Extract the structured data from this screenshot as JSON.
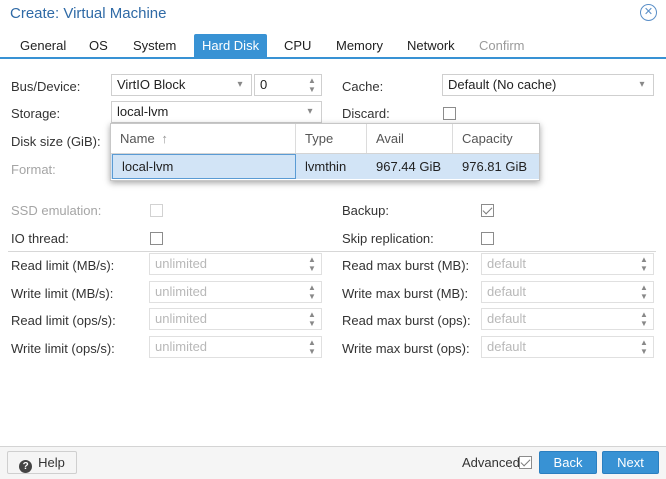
{
  "window": {
    "title": "Create: Virtual Machine"
  },
  "tabs": [
    {
      "label": "General"
    },
    {
      "label": "OS"
    },
    {
      "label": "System"
    },
    {
      "label": "Hard Disk"
    },
    {
      "label": "CPU"
    },
    {
      "label": "Memory"
    },
    {
      "label": "Network"
    },
    {
      "label": "Confirm"
    }
  ],
  "disk": {
    "bus_label": "Bus/Device:",
    "bus_value": "VirtIO Block",
    "device_value": "0",
    "storage_label": "Storage:",
    "storage_value": "local-lvm",
    "size_label": "Disk size (GiB):",
    "format_label": "Format:",
    "cache_label": "Cache:",
    "cache_value": "Default (No cache)",
    "discard_label": "Discard:"
  },
  "storage_picker": {
    "columns": [
      "Name",
      "Type",
      "Avail",
      "Capacity"
    ],
    "sort_arrow": "↑",
    "rows": [
      {
        "name": "local-lvm",
        "type": "lvmthin",
        "avail": "967.44 GiB",
        "capacity": "976.81 GiB"
      }
    ]
  },
  "advanced": {
    "ssd_label": "SSD emulation:",
    "iothread_label": "IO thread:",
    "backup_label": "Backup:",
    "skip_replication_label": "Skip replication:",
    "limits_left": [
      {
        "label": "Read limit (MB/s):",
        "placeholder": "unlimited"
      },
      {
        "label": "Write limit (MB/s):",
        "placeholder": "unlimited"
      },
      {
        "label": "Read limit (ops/s):",
        "placeholder": "unlimited"
      },
      {
        "label": "Write limit (ops/s):",
        "placeholder": "unlimited"
      }
    ],
    "limits_right": [
      {
        "label": "Read max burst (MB):",
        "placeholder": "default"
      },
      {
        "label": "Write max burst (MB):",
        "placeholder": "default"
      },
      {
        "label": "Read max burst (ops):",
        "placeholder": "default"
      },
      {
        "label": "Write max burst (ops):",
        "placeholder": "default"
      }
    ]
  },
  "footer": {
    "help_label": "Help",
    "help_icon": "?",
    "advanced_label": "Advanced",
    "back_label": "Back",
    "next_label": "Next"
  },
  "colors": {
    "accent": "#3892d4",
    "title": "#2f6aa6",
    "selection": "#d2e4f6"
  }
}
